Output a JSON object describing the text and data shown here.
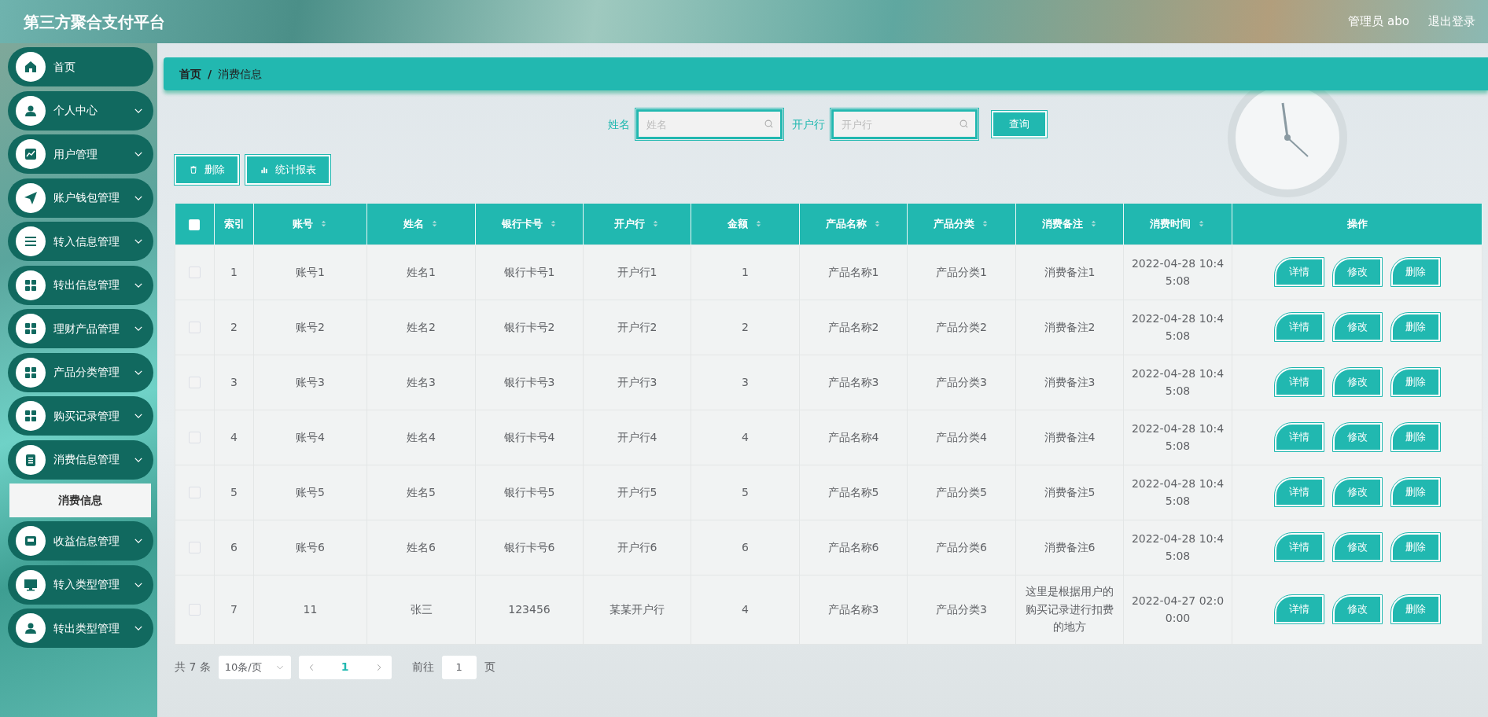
{
  "header": {
    "title": "第三方聚合支付平台",
    "user": "管理员 abo",
    "logout": "退出登录"
  },
  "sidebar": {
    "items": [
      {
        "label": "首页",
        "kind": "home"
      },
      {
        "label": "个人中心",
        "kind": "person",
        "submenu": true
      },
      {
        "label": "用户管理",
        "kind": "chart",
        "submenu": true
      },
      {
        "label": "账户钱包管理",
        "kind": "plane",
        "submenu": true
      },
      {
        "label": "转入信息管理",
        "kind": "list",
        "submenu": true
      },
      {
        "label": "转出信息管理",
        "kind": "grid",
        "submenu": true
      },
      {
        "label": "理财产品管理",
        "kind": "grid",
        "submenu": true
      },
      {
        "label": "产品分类管理",
        "kind": "grid",
        "submenu": true
      },
      {
        "label": "购买记录管理",
        "kind": "grid",
        "submenu": true
      },
      {
        "label": "消费信息管理",
        "kind": "clipboard",
        "submenu": true,
        "children": [
          {
            "label": "消费信息",
            "selected": true
          }
        ]
      },
      {
        "label": "收益信息管理",
        "kind": "tray",
        "submenu": true
      },
      {
        "label": "转入类型管理",
        "kind": "monitor",
        "submenu": true
      },
      {
        "label": "转出类型管理",
        "kind": "person",
        "submenu": true
      }
    ]
  },
  "breadcrumb": {
    "items": [
      "首页",
      "消费信息"
    ],
    "separator": "/"
  },
  "search": {
    "fields": [
      {
        "label": "姓名",
        "placeholder": "姓名"
      },
      {
        "label": "开户行",
        "placeholder": "开户行"
      }
    ],
    "button": "查询"
  },
  "toolbar": [
    {
      "label": "删除",
      "kind": "delete"
    },
    {
      "label": "统计报表",
      "kind": "chart"
    }
  ],
  "table": {
    "header_checked": false,
    "columns": [
      {
        "label": "索引",
        "sortable": false
      },
      {
        "label": "账号",
        "sortable": true
      },
      {
        "label": "姓名",
        "sortable": true
      },
      {
        "label": "银行卡号",
        "sortable": true
      },
      {
        "label": "开户行",
        "sortable": true
      },
      {
        "label": "金额",
        "sortable": true
      },
      {
        "label": "产品名称",
        "sortable": true
      },
      {
        "label": "产品分类",
        "sortable": true
      },
      {
        "label": "消费备注",
        "sortable": true
      },
      {
        "label": "消费时间",
        "sortable": true
      },
      {
        "label": "操作",
        "sortable": false
      }
    ],
    "rows": [
      {
        "checked": false,
        "cells": [
          "1",
          "账号1",
          "姓名1",
          "银行卡号1",
          "开户行1",
          "1",
          "产品名称1",
          "产品分类1",
          "消费备注1",
          "2022-04-28 10:45:08"
        ],
        "actions": [
          "详情",
          "修改",
          "删除"
        ]
      },
      {
        "checked": false,
        "cells": [
          "2",
          "账号2",
          "姓名2",
          "银行卡号2",
          "开户行2",
          "2",
          "产品名称2",
          "产品分类2",
          "消费备注2",
          "2022-04-28 10:45:08"
        ],
        "actions": [
          "详情",
          "修改",
          "删除"
        ]
      },
      {
        "checked": false,
        "cells": [
          "3",
          "账号3",
          "姓名3",
          "银行卡号3",
          "开户行3",
          "3",
          "产品名称3",
          "产品分类3",
          "消费备注3",
          "2022-04-28 10:45:08"
        ],
        "actions": [
          "详情",
          "修改",
          "删除"
        ]
      },
      {
        "checked": false,
        "cells": [
          "4",
          "账号4",
          "姓名4",
          "银行卡号4",
          "开户行4",
          "4",
          "产品名称4",
          "产品分类4",
          "消费备注4",
          "2022-04-28 10:45:08"
        ],
        "actions": [
          "详情",
          "修改",
          "删除"
        ]
      },
      {
        "checked": false,
        "cells": [
          "5",
          "账号5",
          "姓名5",
          "银行卡号5",
          "开户行5",
          "5",
          "产品名称5",
          "产品分类5",
          "消费备注5",
          "2022-04-28 10:45:08"
        ],
        "actions": [
          "详情",
          "修改",
          "删除"
        ]
      },
      {
        "checked": false,
        "cells": [
          "6",
          "账号6",
          "姓名6",
          "银行卡号6",
          "开户行6",
          "6",
          "产品名称6",
          "产品分类6",
          "消费备注6",
          "2022-04-28 10:45:08"
        ],
        "actions": [
          "详情",
          "修改",
          "删除"
        ]
      },
      {
        "checked": false,
        "cells": [
          "7",
          "11",
          "张三",
          "123456",
          "某某开户行",
          "4",
          "产品名称3",
          "产品分类3",
          "这里是根据用户的购买记录进行扣费的地方",
          "2022-04-27 02:00:00"
        ],
        "actions": [
          "详情",
          "修改",
          "删除"
        ]
      }
    ]
  },
  "pagination": {
    "total": "共 7 条",
    "page_size": "10条/页",
    "pages": [
      {
        "label": "1",
        "selected": true
      }
    ],
    "goto_label": "前往",
    "goto_value": "1",
    "goto_suffix": "页"
  }
}
